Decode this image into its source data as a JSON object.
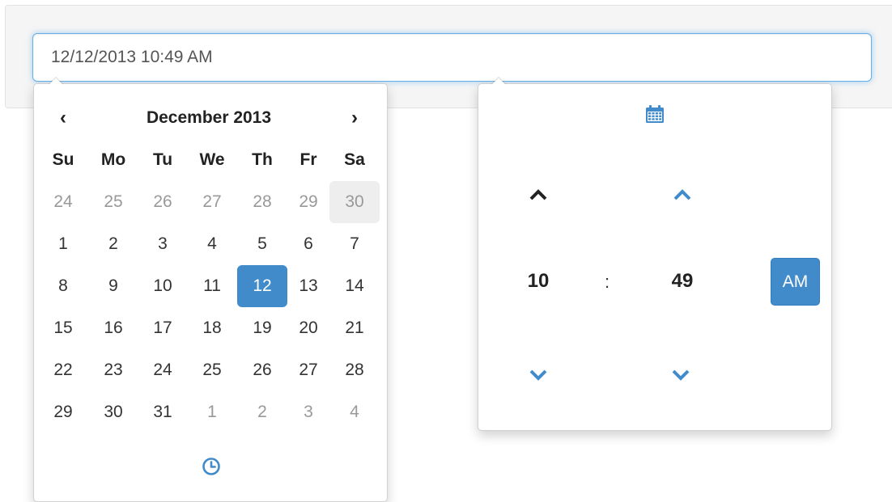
{
  "input": {
    "value": "12/12/2013 10:49 AM"
  },
  "date_picker": {
    "prev": "‹",
    "next": "›",
    "month_year": "December 2013",
    "weekdays": [
      "Su",
      "Mo",
      "Tu",
      "We",
      "Th",
      "Fr",
      "Sa"
    ],
    "weeks": [
      [
        "24",
        "25",
        "26",
        "27",
        "28",
        "29",
        "30"
      ],
      [
        "1",
        "2",
        "3",
        "4",
        "5",
        "6",
        "7"
      ],
      [
        "8",
        "9",
        "10",
        "11",
        "12",
        "13",
        "14"
      ],
      [
        "15",
        "16",
        "17",
        "18",
        "19",
        "20",
        "21"
      ],
      [
        "22",
        "23",
        "24",
        "25",
        "26",
        "27",
        "28"
      ],
      [
        "29",
        "30",
        "31",
        "1",
        "2",
        "3",
        "4"
      ]
    ],
    "selected_day": "12",
    "toggle_icon": "clock-icon"
  },
  "time_picker": {
    "hour": "10",
    "separator": ":",
    "minute": "49",
    "period": "AM",
    "toggle_icon": "calendar-icon"
  },
  "colors": {
    "accent": "#428bca",
    "hover": "#eeeeee",
    "muted": "#999999",
    "focus_border": "#66afe9"
  }
}
